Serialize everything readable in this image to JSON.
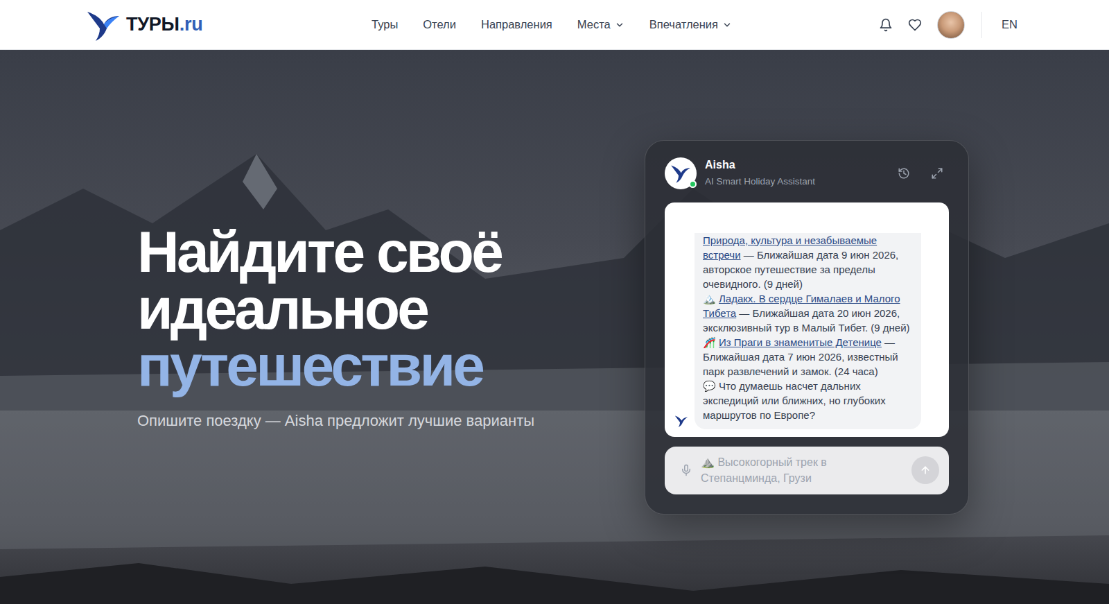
{
  "header": {
    "logo": {
      "name": "ТУРЫ",
      "tld": ".ru"
    },
    "nav": [
      {
        "label": "Туры",
        "dropdown": false
      },
      {
        "label": "Отели",
        "dropdown": false
      },
      {
        "label": "Направления",
        "dropdown": false
      },
      {
        "label": "Места",
        "dropdown": true
      },
      {
        "label": "Впечатления",
        "dropdown": true
      }
    ],
    "language": "EN"
  },
  "hero": {
    "title_lines": [
      "Найдите своё",
      "идеальное"
    ],
    "title_accent": "путешествие",
    "subtitle": "Опишите поездку — Aisha предложит лучшие варианты"
  },
  "chat": {
    "name": "Aisha",
    "role": "AI Smart Holiday Assistant",
    "online": true,
    "message": {
      "items": [
        {
          "link": "Природа, культура и незабываемые встречи",
          "details": " — Ближайшая дата 9 июн 2026, авторское путешествие за пределы очевидного. (9 дней)"
        },
        {
          "icon": "🏔️",
          "link": "Ладакх. В сердце Гималаев и Малого Тибета",
          "details": " — Ближайшая дата 20 июн 2026, эксклюзивный тур в Малый Тибет. (9 дней)"
        },
        {
          "icon": "🎢",
          "link": "Из Праги в знаменитые Детенице",
          "details": " — Ближайшая дата 7 июн 2026, известный парк развлечений и замок. (24 часа)"
        }
      ],
      "question": {
        "icon": "💬",
        "text": "Что думаешь насчет дальних экспедиций или ближних, но глубоких маршрутов по Европе?"
      }
    },
    "input": {
      "placeholder": "⛰️ Высокогорный трек в Степанцминда, Грузи"
    }
  }
}
